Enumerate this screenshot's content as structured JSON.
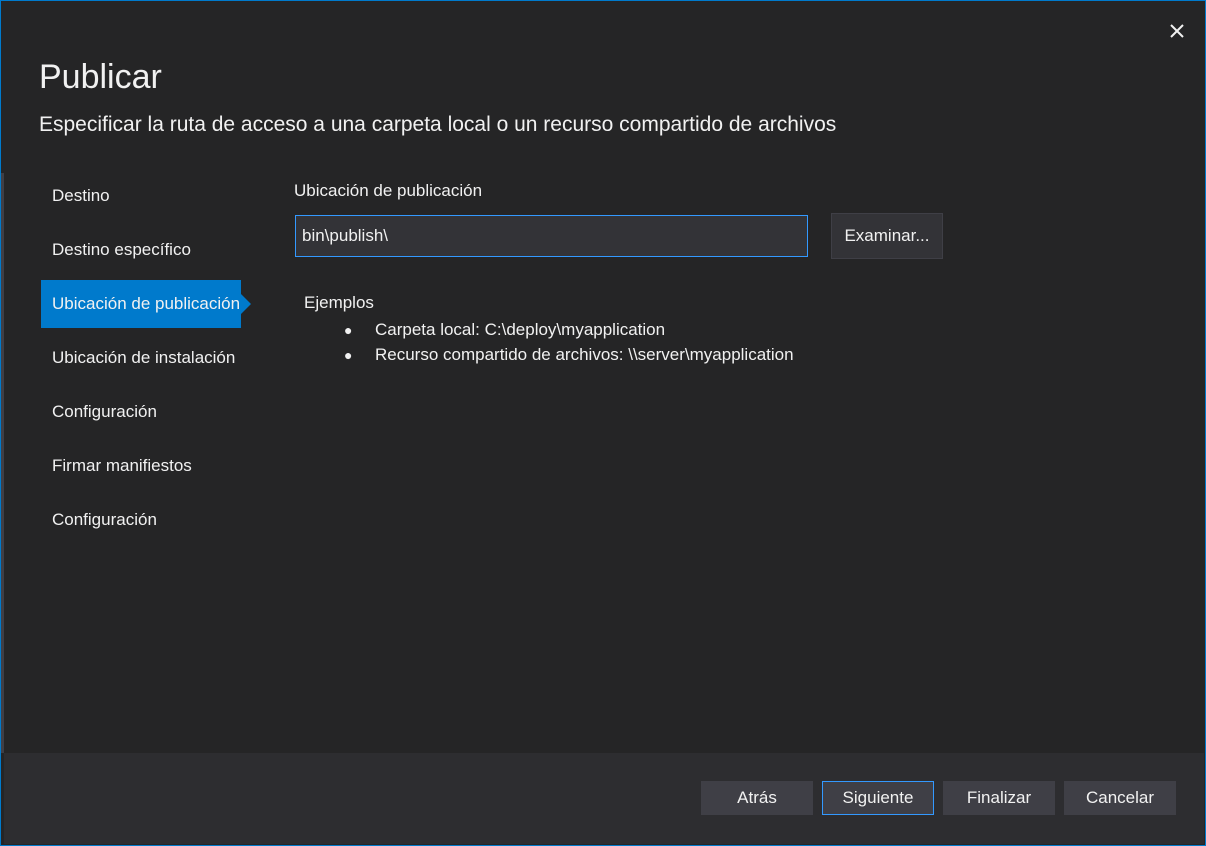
{
  "dialog": {
    "title": "Publicar",
    "subtitle": "Especificar la ruta de acceso a una carpeta local o un recurso compartido de archivos",
    "close_icon": "close-icon"
  },
  "nav": {
    "items": [
      {
        "label": "Destino",
        "active": false
      },
      {
        "label": "Destino específico",
        "active": false
      },
      {
        "label": "Ubicación de publicación",
        "active": true
      },
      {
        "label": "Ubicación de instalación",
        "active": false
      },
      {
        "label": "Configuración",
        "active": false
      },
      {
        "label": "Firmar manifiestos",
        "active": false
      },
      {
        "label": "Configuración",
        "active": false
      }
    ]
  },
  "main": {
    "field_label": "Ubicación de publicación",
    "path_value": "bin\\publish\\",
    "browse_label": "Examinar...",
    "examples_label": "Ejemplos",
    "examples": [
      "Carpeta local: C:\\deploy\\myapplication",
      "Recurso compartido de archivos: \\\\server\\myapplication"
    ]
  },
  "footer": {
    "back_label": "Atrás",
    "next_label": "Siguiente",
    "finish_label": "Finalizar",
    "cancel_label": "Cancelar"
  },
  "colors": {
    "accent": "#007acc",
    "background": "#252526",
    "footer_background": "#2d2d30",
    "focus_border": "#3399ff"
  }
}
